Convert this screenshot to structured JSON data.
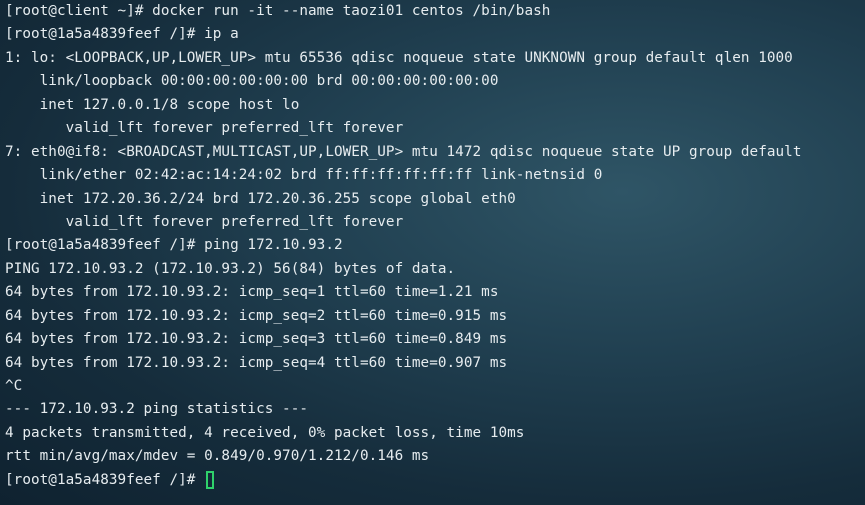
{
  "terminal": {
    "lines": [
      "[root@client ~]# docker run -it --name taozi01 centos /bin/bash",
      "[root@1a5a4839feef /]# ip a",
      "1: lo: <LOOPBACK,UP,LOWER_UP> mtu 65536 qdisc noqueue state UNKNOWN group default qlen 1000",
      "    link/loopback 00:00:00:00:00:00 brd 00:00:00:00:00:00",
      "    inet 127.0.0.1/8 scope host lo",
      "       valid_lft forever preferred_lft forever",
      "7: eth0@if8: <BROADCAST,MULTICAST,UP,LOWER_UP> mtu 1472 qdisc noqueue state UP group default",
      "    link/ether 02:42:ac:14:24:02 brd ff:ff:ff:ff:ff:ff link-netnsid 0",
      "    inet 172.20.36.2/24 brd 172.20.36.255 scope global eth0",
      "       valid_lft forever preferred_lft forever",
      "[root@1a5a4839feef /]# ping 172.10.93.2",
      "PING 172.10.93.2 (172.10.93.2) 56(84) bytes of data.",
      "64 bytes from 172.10.93.2: icmp_seq=1 ttl=60 time=1.21 ms",
      "64 bytes from 172.10.93.2: icmp_seq=2 ttl=60 time=0.915 ms",
      "64 bytes from 172.10.93.2: icmp_seq=3 ttl=60 time=0.849 ms",
      "64 bytes from 172.10.93.2: icmp_seq=4 ttl=60 time=0.907 ms",
      "^C",
      "--- 172.10.93.2 ping statistics ---",
      "4 packets transmitted, 4 received, 0% packet loss, time 10ms",
      "rtt min/avg/max/mdev = 0.849/0.970/1.212/0.146 ms"
    ],
    "final_prompt": "[root@1a5a4839feef /]# ",
    "cursor_icon": "block-cursor-icon",
    "colors": {
      "text": "#e6ecef",
      "cursor": "#2fd16b",
      "background": "#203f50"
    }
  }
}
